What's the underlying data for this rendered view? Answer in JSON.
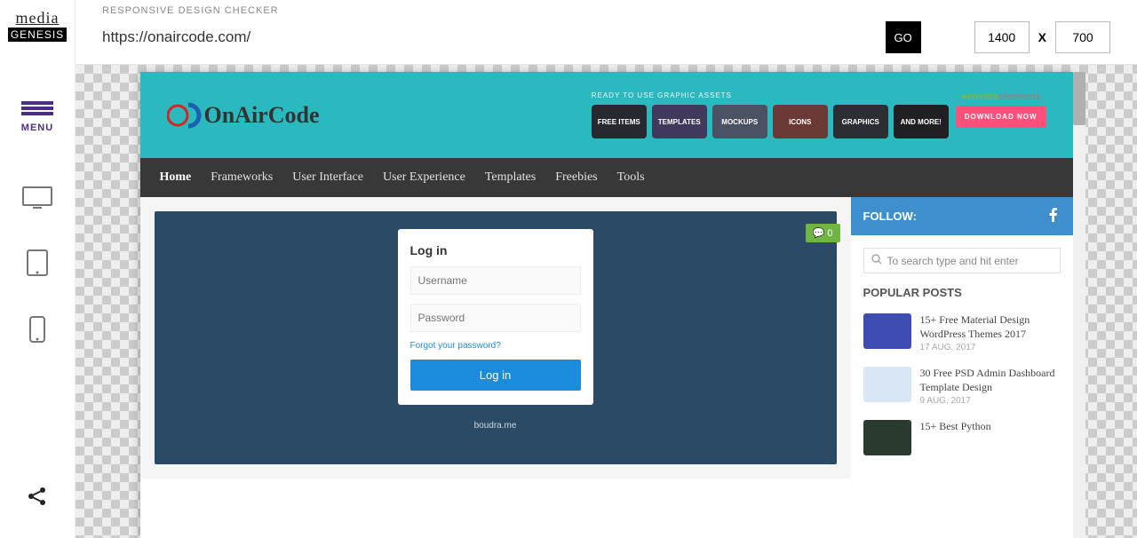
{
  "sidebar": {
    "logo_top": "media",
    "logo_bottom": "GENESIS",
    "menu_label": "MENU"
  },
  "toolbar": {
    "title": "RESPONSIVE DESIGN CHECKER",
    "url": "https://onaircode.com/",
    "go_label": "GO",
    "width": "1400",
    "height": "700",
    "separator": "X"
  },
  "site": {
    "logo_text": "OnAirCode",
    "assets_heading": "READY TO USE GRAPHIC ASSETS",
    "asset_tiles": [
      "FREE ITEMS",
      "TEMPLATES",
      "MOCKUPS",
      "ICONS",
      "GRAPHICS",
      "AND MORE!"
    ],
    "tile_colors": [
      "#272830",
      "#41395c",
      "#4a5264",
      "#6b3a36",
      "#2d2e33",
      "#1f1f24"
    ],
    "envato_brand": "envato",
    "envato_suffix": "elements",
    "download_label": "DOWNLOAD NOW",
    "nav": [
      "Home",
      "Frameworks",
      "User Interface",
      "User Experience",
      "Templates",
      "Freebies",
      "Tools"
    ],
    "comment_count": "0",
    "login": {
      "title": "Log in",
      "username_ph": "Username",
      "password_ph": "Password",
      "forgot": "Forgot your password?",
      "button": "Log in",
      "credit": "boudra.me"
    },
    "aside": {
      "follow": "FOLLOW:",
      "search_ph": "To search type and hit enter",
      "pop_heading": "POPULAR POSTS",
      "posts": [
        {
          "title": "15+ Free Material Design WordPress Themes 2017",
          "date": "17 AUG, 2017",
          "thumb": "#3f4db3"
        },
        {
          "title": "30 Free PSD Admin Dashboard Template Design",
          "date": "9 AUG, 2017",
          "thumb": "#d9e7f5"
        },
        {
          "title": "15+ Best Python",
          "date": "",
          "thumb": "#2b3a2f"
        }
      ]
    }
  }
}
